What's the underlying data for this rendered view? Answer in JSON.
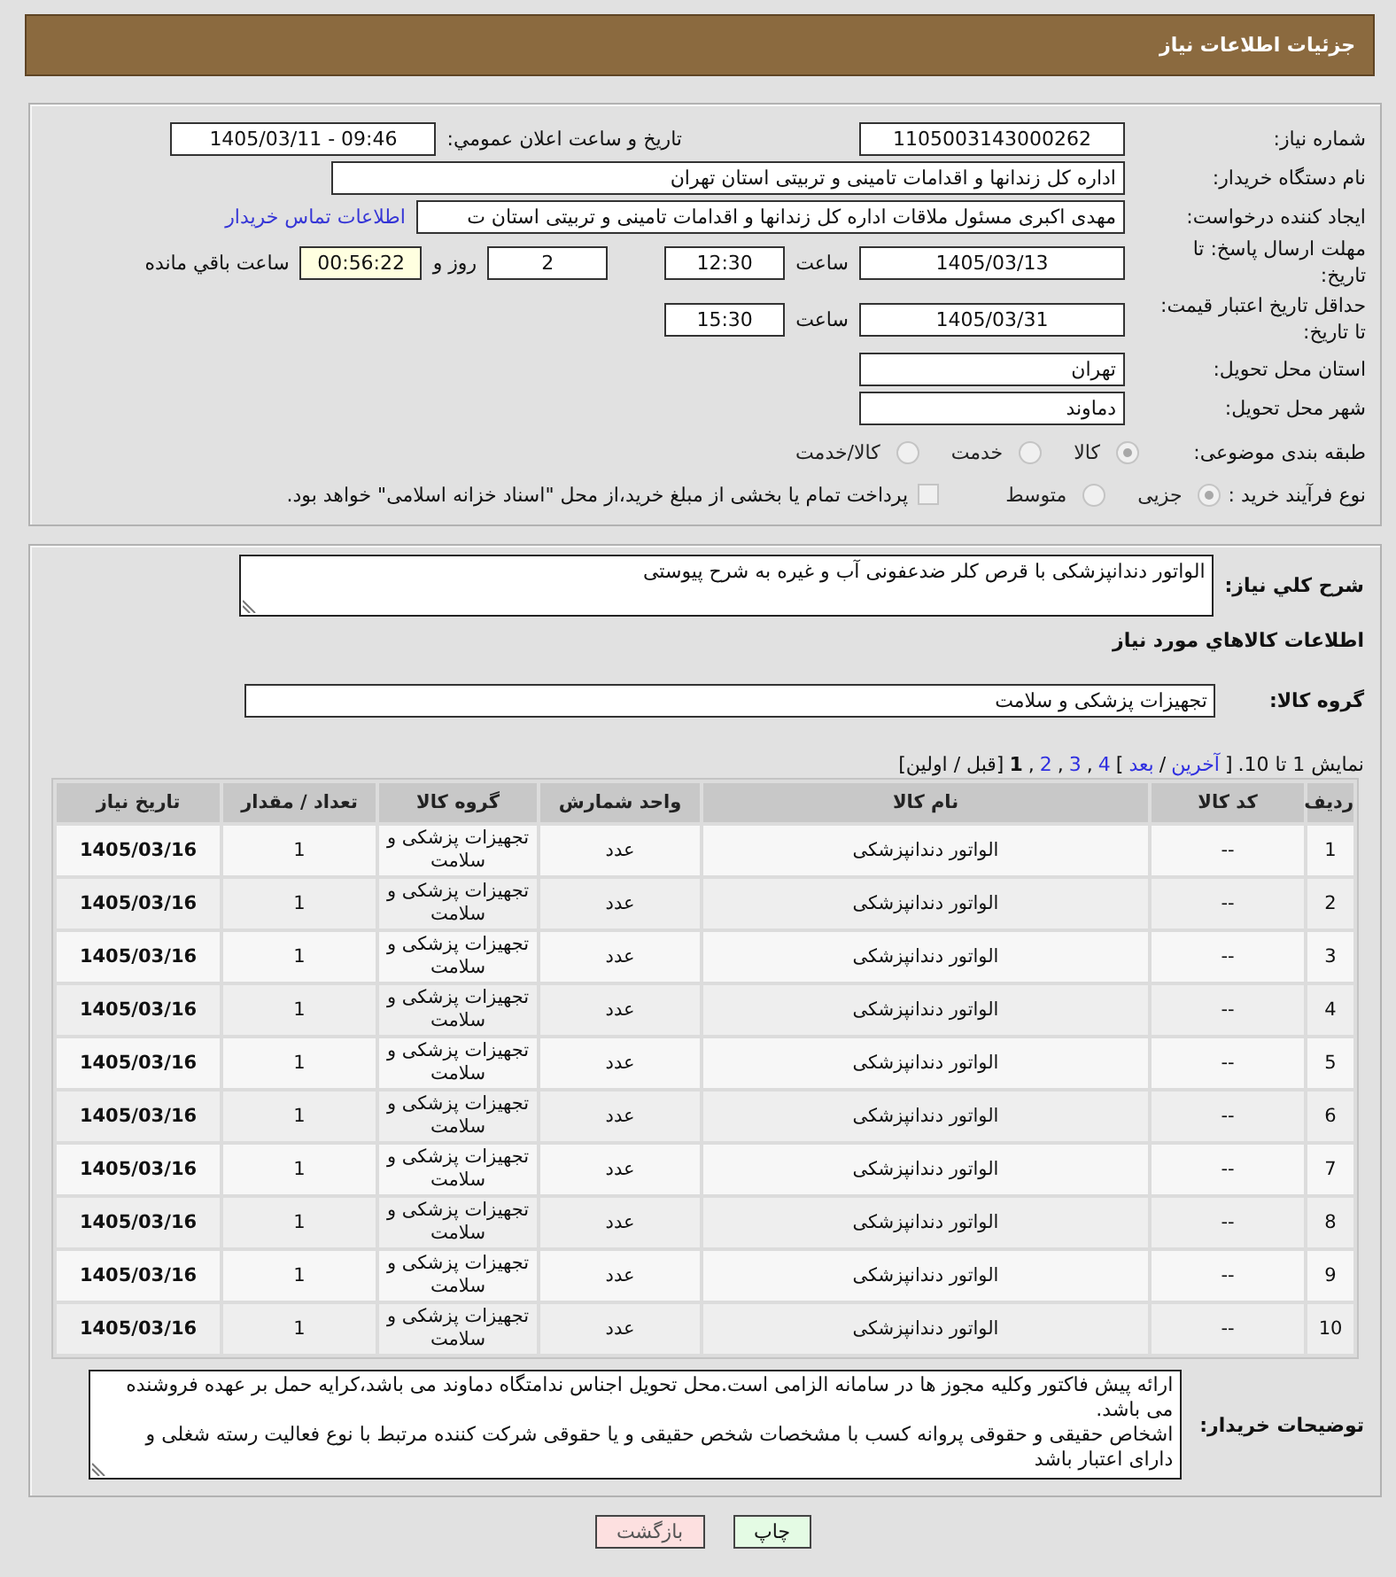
{
  "header": {
    "title": "جزئیات اطلاعات نیاز"
  },
  "form": {
    "need_number": {
      "label": "شماره نیاز:",
      "value": "1105003143000262"
    },
    "announcement": {
      "label": "تاریخ و ساعت اعلان عمومي:",
      "value": "1405/03/11 - 09:46"
    },
    "buyer_org": {
      "label": "نام دستگاه خریدار:",
      "value": "اداره کل زندانها و اقدامات تامینی و تربیتی استان تهران"
    },
    "requester": {
      "label": "ایجاد کننده درخواست:",
      "value": "مهدی اکبری مسئول ملاقات  اداره کل زندانها و اقدامات تامینی و تربیتی استان ت",
      "link": "اطلاعات تماس خریدار"
    },
    "reply_deadline": {
      "label": "مهلت ارسال پاسخ: تا تاریخ:",
      "date": "1405/03/13",
      "time_label": "ساعت",
      "time": "12:30",
      "days": "2",
      "days_label": "روز و",
      "remaining": "00:56:22",
      "remaining_label": "ساعت باقي مانده"
    },
    "price_validity": {
      "label": "حداقل تاریخ اعتبار قیمت: تا تاریخ:",
      "date": "1405/03/31",
      "time_label": "ساعت",
      "time": "15:30"
    },
    "province": {
      "label": "استان محل تحویل:",
      "value": "تهران"
    },
    "city": {
      "label": "شهر محل تحویل:",
      "value": "دماوند"
    },
    "category": {
      "label": "طبقه بندی موضوعی:",
      "options": [
        {
          "label": "کالا",
          "selected": true,
          "disabled": true
        },
        {
          "label": "خدمت",
          "selected": false,
          "disabled": true
        },
        {
          "label": "کالا/خدمت",
          "selected": false,
          "disabled": true
        }
      ]
    },
    "purchase_type": {
      "label": "نوع فرآیند خرید :",
      "options": [
        {
          "label": "جزیی",
          "selected": true,
          "disabled": true
        },
        {
          "label": "متوسط",
          "selected": false,
          "disabled": true
        }
      ],
      "treasury": {
        "label": "پرداخت تمام یا بخشی از مبلغ خرید،از محل \"اسناد خزانه اسلامی\" خواهد بود.",
        "checked": false,
        "disabled": true
      }
    }
  },
  "details": {
    "description": {
      "label": "شرح کلي نیاز:",
      "value": "الواتور دندانپزشکی با قرص کلر ضدعفونی آب و غیره به شرح پیوستی"
    },
    "goods_heading": "اطلاعات کالاهاي مورد نیاز",
    "goods_group": {
      "label": "گروه کالا:",
      "value": "تجهیزات پزشکی و سلامت"
    },
    "pagination": [
      {
        "kind": "text",
        "text": "نمایش 1 تا 10."
      },
      {
        "kind": "text",
        "text": "["
      },
      {
        "kind": "link",
        "text": "آخرین"
      },
      {
        "kind": "text",
        "text": "/"
      },
      {
        "kind": "link",
        "text": "بعد"
      },
      {
        "kind": "text",
        "text": "]"
      },
      {
        "kind": "link",
        "text": "4"
      },
      {
        "kind": "text",
        "text": ","
      },
      {
        "kind": "link",
        "text": "3"
      },
      {
        "kind": "text",
        "text": ","
      },
      {
        "kind": "link",
        "text": "2"
      },
      {
        "kind": "text",
        "text": ","
      },
      {
        "kind": "current",
        "text": "1"
      },
      {
        "kind": "text",
        "text": "[قبل / اولین]"
      }
    ],
    "table": {
      "columns": [
        {
          "label": "ردیف",
          "kind": "text"
        },
        {
          "label": "کد کالا",
          "kind": "text"
        },
        {
          "label": "نام کالا",
          "kind": "text"
        },
        {
          "label": "واحد شمارش",
          "kind": "text"
        },
        {
          "label": "گروه کالا",
          "kind": "text"
        },
        {
          "label": "تعداد / مقدار",
          "kind": "text"
        },
        {
          "label": "تاریخ نیاز",
          "kind": "date"
        }
      ],
      "rows": [
        [
          "1",
          "--",
          "الواتور دندانپزشکی",
          "عدد",
          "تجهیزات پزشکی و سلامت",
          "1",
          "1405/03/16"
        ],
        [
          "2",
          "--",
          "الواتور دندانپزشکی",
          "عدد",
          "تجهیزات پزشکی و سلامت",
          "1",
          "1405/03/16"
        ],
        [
          "3",
          "--",
          "الواتور دندانپزشکی",
          "عدد",
          "تجهیزات پزشکی و سلامت",
          "1",
          "1405/03/16"
        ],
        [
          "4",
          "--",
          "الواتور دندانپزشکی",
          "عدد",
          "تجهیزات پزشکی و سلامت",
          "1",
          "1405/03/16"
        ],
        [
          "5",
          "--",
          "الواتور دندانپزشکی",
          "عدد",
          "تجهیزات پزشکی و سلامت",
          "1",
          "1405/03/16"
        ],
        [
          "6",
          "--",
          "الواتور دندانپزشکی",
          "عدد",
          "تجهیزات پزشکی و سلامت",
          "1",
          "1405/03/16"
        ],
        [
          "7",
          "--",
          "الواتور دندانپزشکی",
          "عدد",
          "تجهیزات پزشکی و سلامت",
          "1",
          "1405/03/16"
        ],
        [
          "8",
          "--",
          "الواتور دندانپزشکی",
          "عدد",
          "تجهیزات پزشکی و سلامت",
          "1",
          "1405/03/16"
        ],
        [
          "9",
          "--",
          "الواتور دندانپزشکی",
          "عدد",
          "تجهیزات پزشکی و سلامت",
          "1",
          "1405/03/16"
        ],
        [
          "10",
          "--",
          "الواتور دندانپزشکی",
          "عدد",
          "تجهیزات پزشکی و سلامت",
          "1",
          "1405/03/16"
        ]
      ]
    },
    "notes": {
      "label": "توضیحات خریدار:",
      "value": "ارائه پیش فاکتور وکلیه مجوز ها در سامانه الزامی است.محل تحویل اجناس ندامتگاه دماوند می باشد،کرایه حمل بر عهده فروشنده می باشد.\nاشخاص حقیقی و حقوقی پروانه کسب با مشخصات شخص حقیقی و یا حقوقی شرکت کننده مرتبط با نوع فعالیت رسته شغلی و دارای اعتبار باشد"
    }
  },
  "buttons": [
    {
      "label": "چاپ",
      "kind": "print"
    },
    {
      "label": "بازگشت",
      "kind": "back"
    }
  ]
}
